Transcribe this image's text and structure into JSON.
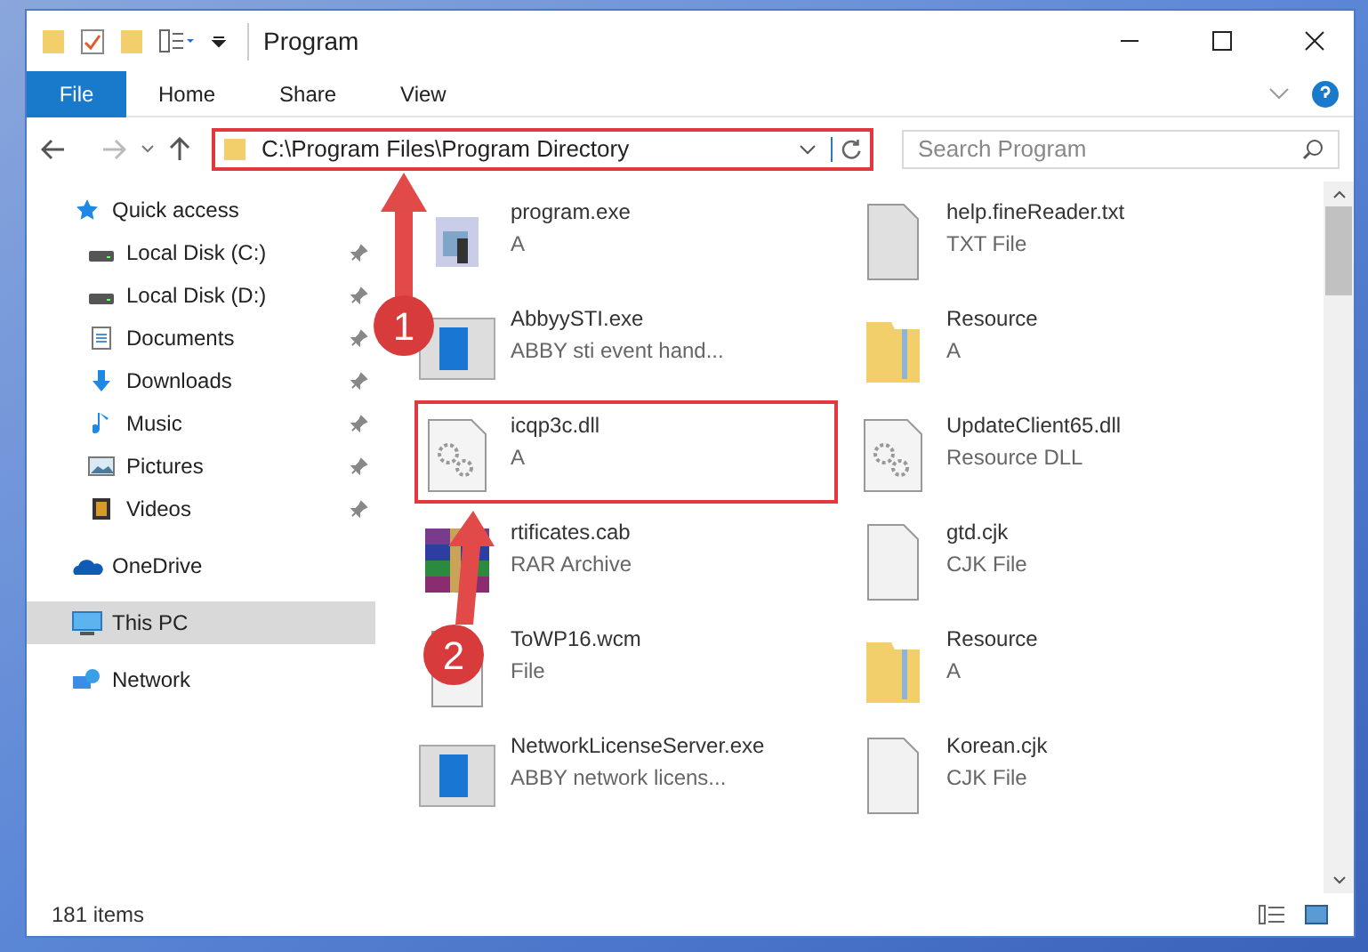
{
  "window": {
    "title": "Program"
  },
  "ribbon_tabs": [
    {
      "label": "File",
      "selected": true
    },
    {
      "label": "Home",
      "selected": false
    },
    {
      "label": "Share",
      "selected": false
    },
    {
      "label": "View",
      "selected": false
    }
  ],
  "address_bar": {
    "value": "C:\\Program Files\\Program Directory"
  },
  "search": {
    "placeholder": "Search Program"
  },
  "sidebar": {
    "items": [
      {
        "label": "Quick access",
        "kind": "star",
        "pinned": false,
        "selected": false,
        "children": [
          {
            "label": "Local Disk (C:)",
            "kind": "drive",
            "pinned": true,
            "selected": false
          },
          {
            "label": "Local Disk (D:)",
            "kind": "drive",
            "pinned": true,
            "selected": false
          },
          {
            "label": "Documents",
            "kind": "document",
            "pinned": true,
            "selected": false
          },
          {
            "label": "Downloads",
            "kind": "download",
            "pinned": true,
            "selected": false
          },
          {
            "label": "Music",
            "kind": "music",
            "pinned": true,
            "selected": false
          },
          {
            "label": "Pictures",
            "kind": "picture",
            "pinned": true,
            "selected": false
          },
          {
            "label": "Videos",
            "kind": "video",
            "pinned": true,
            "selected": false
          }
        ]
      },
      {
        "label": "OneDrive",
        "kind": "cloud",
        "pinned": false,
        "selected": false
      },
      {
        "label": "This PC",
        "kind": "pc",
        "pinned": false,
        "selected": true
      },
      {
        "label": "Network",
        "kind": "network",
        "pinned": false,
        "selected": false
      }
    ]
  },
  "files": [
    {
      "name": "program.exe",
      "type": "A",
      "kind": "setup"
    },
    {
      "name": "help.fineReader.txt",
      "type": "TXT File",
      "kind": "text"
    },
    {
      "name": "AbbyySTI.exe",
      "type": "ABBY sti event hand...",
      "kind": "exe"
    },
    {
      "name": "Resource",
      "type": "A",
      "kind": "folder"
    },
    {
      "name": "icqp3c.dll",
      "type": "A",
      "kind": "dll"
    },
    {
      "name": "UpdateClient65.dll",
      "type": "Resource DLL",
      "kind": "dll"
    },
    {
      "name": "rtificates.cab",
      "type": "RAR Archive",
      "kind": "archive"
    },
    {
      "name": "gtd.cjk",
      "type": "CJK File",
      "kind": "blank"
    },
    {
      "name": "ToWP16.wcm",
      "type": "File",
      "kind": "blank"
    },
    {
      "name": "Resource",
      "type": "A",
      "kind": "folder"
    },
    {
      "name": "NetworkLicenseServer.exe",
      "type": "ABBY network licens...",
      "kind": "exe"
    },
    {
      "name": "Korean.cjk",
      "type": "CJK File",
      "kind": "blank"
    }
  ],
  "status_bar": {
    "count": "181 items"
  },
  "annotations": [
    {
      "number": "1"
    },
    {
      "number": "2"
    }
  ]
}
